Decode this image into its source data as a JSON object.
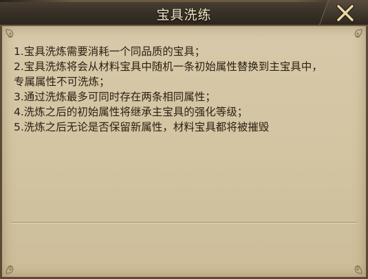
{
  "dialog": {
    "title": "宝具洗练",
    "close_icon": "close-x-icon",
    "rules": [
      "1.宝具洗炼需要消耗一个同品质的宝具；",
      "2.宝具洗炼将会从材料宝具中随机一条初始属性替换到主宝具中，",
      "专属属性不可洗炼；",
      "3.通过洗炼最多可同时存在两条相同属性；",
      "4.洗炼之后的初始属性将继承主宝具的强化等级；",
      "5.洗炼之后无论是否保留新属性，材料宝具都将被摧毁"
    ]
  },
  "colors": {
    "title_bar": "#3a3228",
    "title_text": "#f1e4c5",
    "panel": "#d3c4a2",
    "body_text": "#2b1f12",
    "close_icon": "#e8d8a8"
  }
}
